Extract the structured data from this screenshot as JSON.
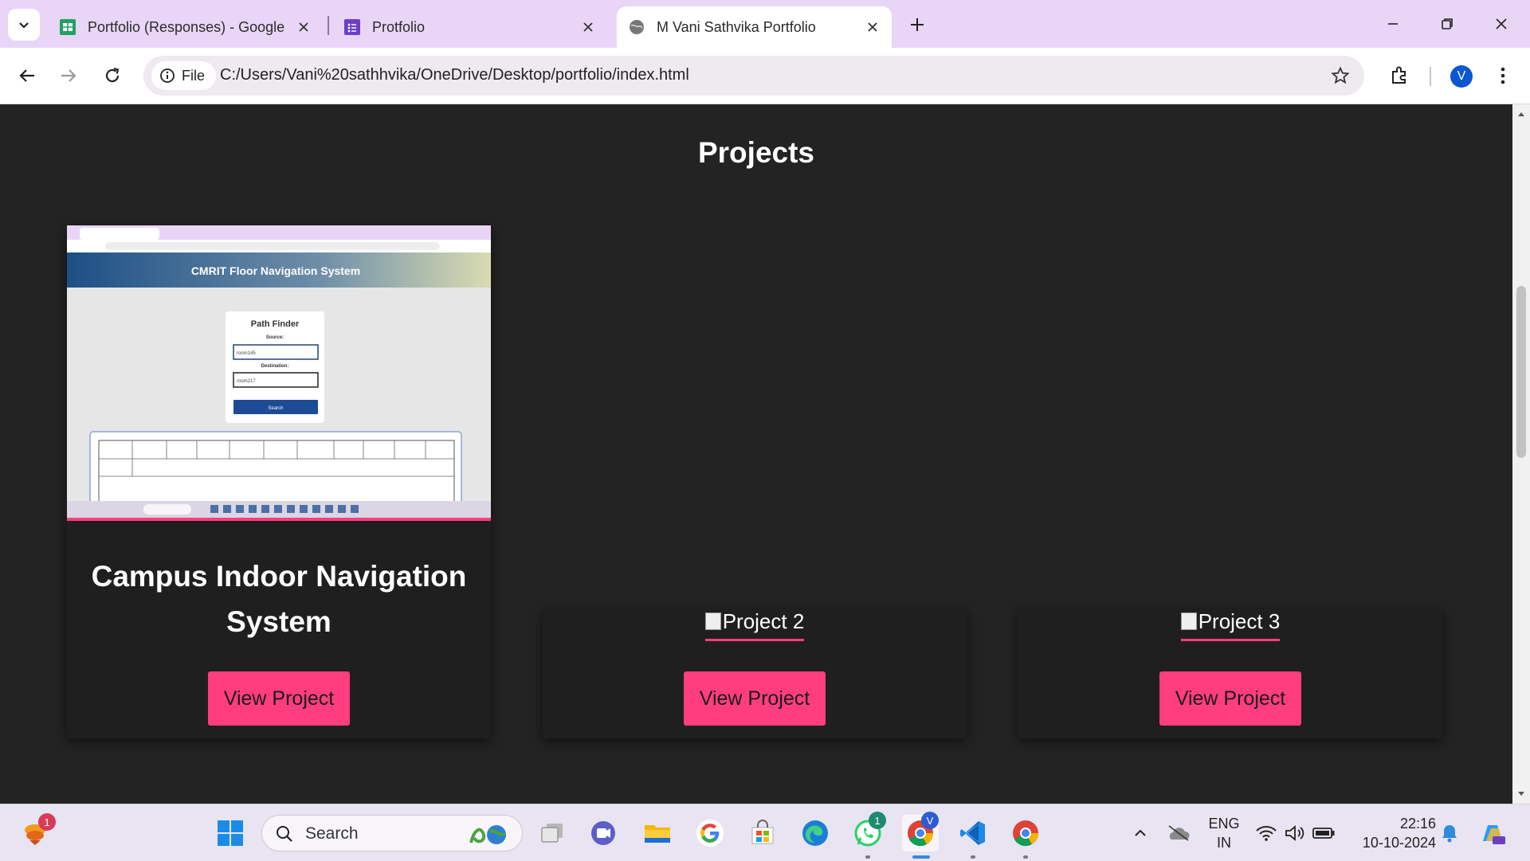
{
  "browser": {
    "tabs": [
      {
        "title": "Portfolio (Responses) - Google",
        "favicon": "google-sheets-icon",
        "active": false
      },
      {
        "title": "Protfolio",
        "favicon": "google-forms-icon",
        "active": false
      },
      {
        "title": "M Vani Sathvika Portfolio",
        "favicon": "globe-icon",
        "active": true
      }
    ],
    "address": {
      "chip_label": "File",
      "url": "C:/Users/Vani%20sathhvika/OneDrive/Desktop/portfolio/index.html"
    },
    "profile_initial": "V"
  },
  "page": {
    "section_title": "Projects",
    "projects": [
      {
        "title": "Campus Indoor Navigation System",
        "button_label": "View Project",
        "screenshot": {
          "banner": "CMRIT Floor Navigation System",
          "form_title": "Path Finder",
          "source_label": "Source:",
          "source_value": "room145",
          "destination_label": "Destination:",
          "destination_value": "room217",
          "search_label": "Search"
        }
      },
      {
        "image_alt": "Project 2",
        "button_label": "View Project"
      },
      {
        "image_alt": "Project 3",
        "button_label": "View Project"
      }
    ],
    "colors": {
      "accent": "#ff3d7f",
      "background": "#232323",
      "card": "#1f1f1f"
    }
  },
  "taskbar": {
    "search_placeholder": "Search",
    "apps": [
      "widgets-icon",
      "start-icon",
      "task-view-icon",
      "teams-icon",
      "file-explorer-icon",
      "google-icon",
      "store-icon",
      "edge-icon",
      "whatsapp-icon",
      "chrome-profile-icon",
      "vscode-icon",
      "chrome-icon"
    ],
    "widgets_badge": "1",
    "whatsapp_badge": "1",
    "chrome_badge": "V",
    "language": {
      "line1": "ENG",
      "line2": "IN"
    },
    "time": "22:16",
    "date": "10-10-2024"
  }
}
